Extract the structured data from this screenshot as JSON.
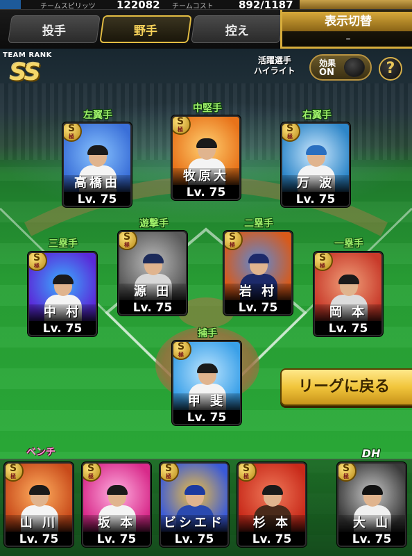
{
  "top_strip": {
    "label1": "チームスピリッツ",
    "value1": "122082",
    "label2": "チームコスト",
    "value2": "892/1187"
  },
  "tabs": [
    {
      "label": "投手",
      "active": false
    },
    {
      "label": "野手",
      "active": true
    },
    {
      "label": "控え",
      "active": false
    }
  ],
  "display_switch": {
    "title": "表示切替",
    "value": "–"
  },
  "team_rank": {
    "label": "TEAM RANK",
    "value": "SS"
  },
  "highlight": {
    "label_line1": "活躍選手",
    "label_line2": "ハイライト",
    "toggle_label": "効果",
    "toggle_state": "ON"
  },
  "help_icon": "?",
  "return_button": "リーグに戻る",
  "rarity_badge": {
    "letter": "S",
    "sub": "極"
  },
  "lineup": {
    "lf": {
      "position": "左翼手",
      "name": "高橋由",
      "level": "Lv. 75",
      "art": [
        "#3a6fd8",
        "#89c4ff"
      ],
      "uniform": "#f4f4f4",
      "cap": "#1a1a1a"
    },
    "cf": {
      "position": "中堅手",
      "name": "牧原大",
      "level": "Lv. 75",
      "art": [
        "#e8731a",
        "#ffd070"
      ],
      "uniform": "#f4f4f4",
      "cap": "#1a1a1a"
    },
    "rf": {
      "position": "右翼手",
      "name": "万 波",
      "level": "Lv. 75",
      "art": [
        "#2d86c8",
        "#cfeaff"
      ],
      "uniform": "#f4f4f4",
      "cap": "#2a6fc0"
    },
    "ss": {
      "position": "遊撃手",
      "name": "源 田",
      "level": "Lv. 75",
      "art": [
        "#5a5a5a",
        "#bdbdbd"
      ],
      "uniform": "#d8d8d8",
      "cap": "#1c2a5a"
    },
    "2b": {
      "position": "二塁手",
      "name": "岩 村",
      "level": "Lv. 75",
      "art": [
        "#d85a1a",
        "#5a8ad8"
      ],
      "uniform": "#1c2a6a",
      "cap": "#1c2a6a"
    },
    "3b": {
      "position": "三塁手",
      "name": "中 村",
      "level": "Lv. 75",
      "art": [
        "#5a2ad8",
        "#3ab0ff"
      ],
      "uniform": "#f4f4f4",
      "cap": "#1a1a1a"
    },
    "1b": {
      "position": "一塁手",
      "name": "岡 本",
      "level": "Lv. 75",
      "art": [
        "#c83a2a",
        "#f0a07a"
      ],
      "uniform": "#dcdcdc",
      "cap": "#1a1a1a"
    },
    "c": {
      "position": "捕手",
      "name": "甲 斐",
      "level": "Lv. 75",
      "art": [
        "#3aa0e8",
        "#bfe6ff"
      ],
      "uniform": "#f4f4f4",
      "cap": "#1a1a1a"
    }
  },
  "bench": {
    "label": "ベンチ",
    "players": [
      {
        "name": "山 川",
        "level": "Lv. 75",
        "art": [
          "#c84a1a",
          "#ffb060"
        ],
        "uniform": "#f4f4f4",
        "cap": "#1a1a1a"
      },
      {
        "name": "坂 本",
        "level": "Lv. 75",
        "art": [
          "#d82a8a",
          "#ffb0e0"
        ],
        "uniform": "#f4f4f4",
        "cap": "#1a1a1a"
      },
      {
        "name": "ビシエド",
        "level": "Lv. 75",
        "art": [
          "#3a5ad8",
          "#f0c040"
        ],
        "uniform": "#2a4ab0",
        "cap": "#1c3aa0"
      },
      {
        "name": "杉 本",
        "level": "Lv. 75",
        "art": [
          "#c82a1a",
          "#f07a5a"
        ],
        "uniform": "#4a2a1a",
        "cap": "#1a1a1a"
      }
    ]
  },
  "dh": {
    "position": "DH",
    "name": "大 山",
    "level": "Lv. 75",
    "art": [
      "#3a3a3a",
      "#c8c8c8"
    ],
    "uniform": "#f0f0f0",
    "cap": "#111111"
  },
  "colors": {
    "accent_gold": "#e2bc43",
    "position_green": "#9ff06a",
    "bench_pink": "#ff9ad6",
    "field_green": "#2bb23a"
  }
}
